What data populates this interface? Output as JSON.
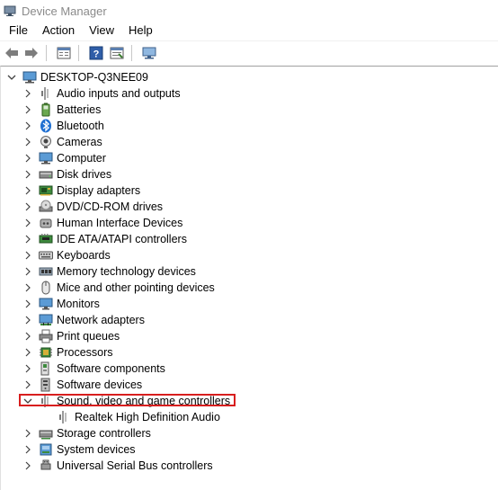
{
  "window": {
    "title": "Device Manager"
  },
  "menu": [
    "File",
    "Action",
    "View",
    "Help"
  ],
  "tree": {
    "root": "DESKTOP-Q3NEE09",
    "categories": [
      {
        "label": "Audio inputs and outputs",
        "icon": "speaker-icon"
      },
      {
        "label": "Batteries",
        "icon": "battery-icon"
      },
      {
        "label": "Bluetooth",
        "icon": "bluetooth-icon"
      },
      {
        "label": "Cameras",
        "icon": "camera-icon"
      },
      {
        "label": "Computer",
        "icon": "computer-icon"
      },
      {
        "label": "Disk drives",
        "icon": "disk-drive-icon"
      },
      {
        "label": "Display adapters",
        "icon": "display-adapter-icon"
      },
      {
        "label": "DVD/CD-ROM drives",
        "icon": "dvd-drive-icon"
      },
      {
        "label": "Human Interface Devices",
        "icon": "hid-icon"
      },
      {
        "label": "IDE ATA/ATAPI controllers",
        "icon": "ide-controller-icon"
      },
      {
        "label": "Keyboards",
        "icon": "keyboard-icon"
      },
      {
        "label": "Memory technology devices",
        "icon": "memory-icon"
      },
      {
        "label": "Mice and other pointing devices",
        "icon": "mouse-icon"
      },
      {
        "label": "Monitors",
        "icon": "monitor-icon"
      },
      {
        "label": "Network adapters",
        "icon": "network-adapter-icon"
      },
      {
        "label": "Print queues",
        "icon": "printer-icon"
      },
      {
        "label": "Processors",
        "icon": "processor-icon"
      },
      {
        "label": "Software components",
        "icon": "software-component-icon"
      },
      {
        "label": "Software devices",
        "icon": "software-device-icon"
      },
      {
        "label": "Sound, video and game controllers",
        "icon": "speaker-icon",
        "expanded": true,
        "children": [
          {
            "label": "Realtek High Definition Audio",
            "icon": "speaker-icon"
          }
        ]
      },
      {
        "label": "Storage controllers",
        "icon": "storage-controller-icon"
      },
      {
        "label": "System devices",
        "icon": "system-devices-icon"
      },
      {
        "label": "Universal Serial Bus controllers",
        "icon": "usb-icon"
      }
    ]
  },
  "colors": {
    "highlight_border": "#d81e1e",
    "title_text": "#8a8a8a"
  }
}
